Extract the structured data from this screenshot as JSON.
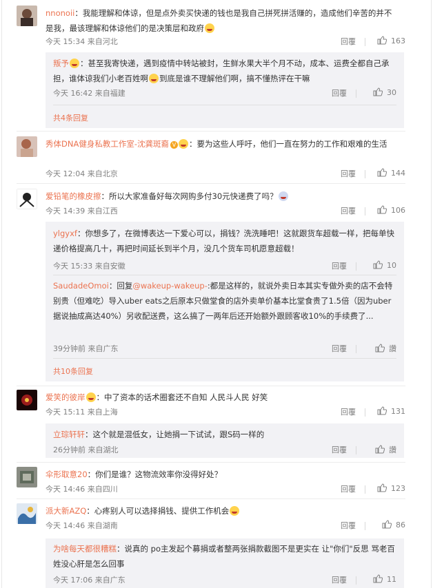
{
  "comments": [
    {
      "user": "nnonoii",
      "text": "我能理解和体谅，但是点外卖买快递的钱也是我自己拼死拼活赚的，造成他们辛苦的并不是我，最该理解和体谅他们的是决策层和政府",
      "time": "今天 15:34 来自河北",
      "reply_label": "回覆",
      "likes": "163",
      "subs": [
        {
          "user": "叛予",
          "text": "甚至我寄快递，遇到疫情中转站被封，生鲜水果大半个月不动，成本、运费全都自己承担，谁体谅我们小老百姓啊",
          "text2": "到底是谁不理解他们啊，搞不懂热评在干嘛",
          "time": "今天 16:42 来自福建",
          "reply_label": "回覆",
          "likes": "30"
        }
      ],
      "more": "共4条回复"
    },
    {
      "user": "秀体DNA健身私教工作室-沈龚斑裔",
      "text": "要为这些人呼吁，他们一直在努力的工作和艰难的生活",
      "time": "今天 12:04 来自北京",
      "reply_label": "回覆",
      "likes": "144"
    },
    {
      "user": "爱铅笔的橡皮擦",
      "text": "所以大家准备好每次网购多付30元快递费了吗？",
      "time": "今天 14:39 来自江西",
      "reply_label": "回覆",
      "likes": "106",
      "subs": [
        {
          "user": "ylgyxf",
          "text": "你想多了，在微博表达一下爱心可以，捐钱？洗洗睡吧！这就跟货车超载一样，把每单快递价格提高几十，再把时间延长到半个月，没几个货车司机愿意超载！",
          "time": "今天 15:33 来自安徽",
          "reply_label": "回覆",
          "likes": "10"
        },
        {
          "user": "SaudadeOmoi",
          "reply_prefix": "回复",
          "mention": "@wakeup-wakeup-",
          "text": ":都是这样的，就说外卖日本其实专做外卖的店不会特别贵（但难吃）导入uber eats之后原本只做堂食的店外卖单价基本比堂食贵了1.5倍（因为uber据说抽成高达40%）另收配送费，这么搞了一两年后还开始额外跟顾客收10%的手续费了...",
          "time": "39分钟前 来自广东",
          "reply_label": "回覆",
          "likes": "讚"
        }
      ],
      "more": "共10条回复"
    },
    {
      "user": "爱笑的彼岸",
      "text": "中了资本的话术圈套还不自知 人民斗人民 好笑",
      "time": "今天 15:11 来自上海",
      "reply_label": "回覆",
      "likes": "131",
      "subs": [
        {
          "user": "立琮轩轩",
          "text": "这个就是混低女，让她捐一下试试，跟S码一样的",
          "time": "26分钟前 来自湖北",
          "reply_label": "回覆",
          "likes": "讚"
        }
      ]
    },
    {
      "user": "伞形取意20",
      "text": "你们是谁？这物流效率你没得好处？",
      "time": "今天 14:46 来自四川",
      "reply_label": "回覆",
      "likes": "123"
    },
    {
      "user": "派大新AZQ",
      "text": "心疼别人可以选择捐钱、提供工作机会",
      "time": "今天 14:46 来自湖南",
      "reply_label": "回覆",
      "likes": "86",
      "subs": [
        {
          "user": "为啥每天都很糟糕",
          "text": "说真的 po主发起个募捐或者整两张捐款截图不是更实在 让\"你们\"反思 骂老百姓没心肝是怎么回事",
          "time": "今天 17:06 来自广东",
          "reply_label": "回覆",
          "likes": "11"
        }
      ]
    }
  ]
}
